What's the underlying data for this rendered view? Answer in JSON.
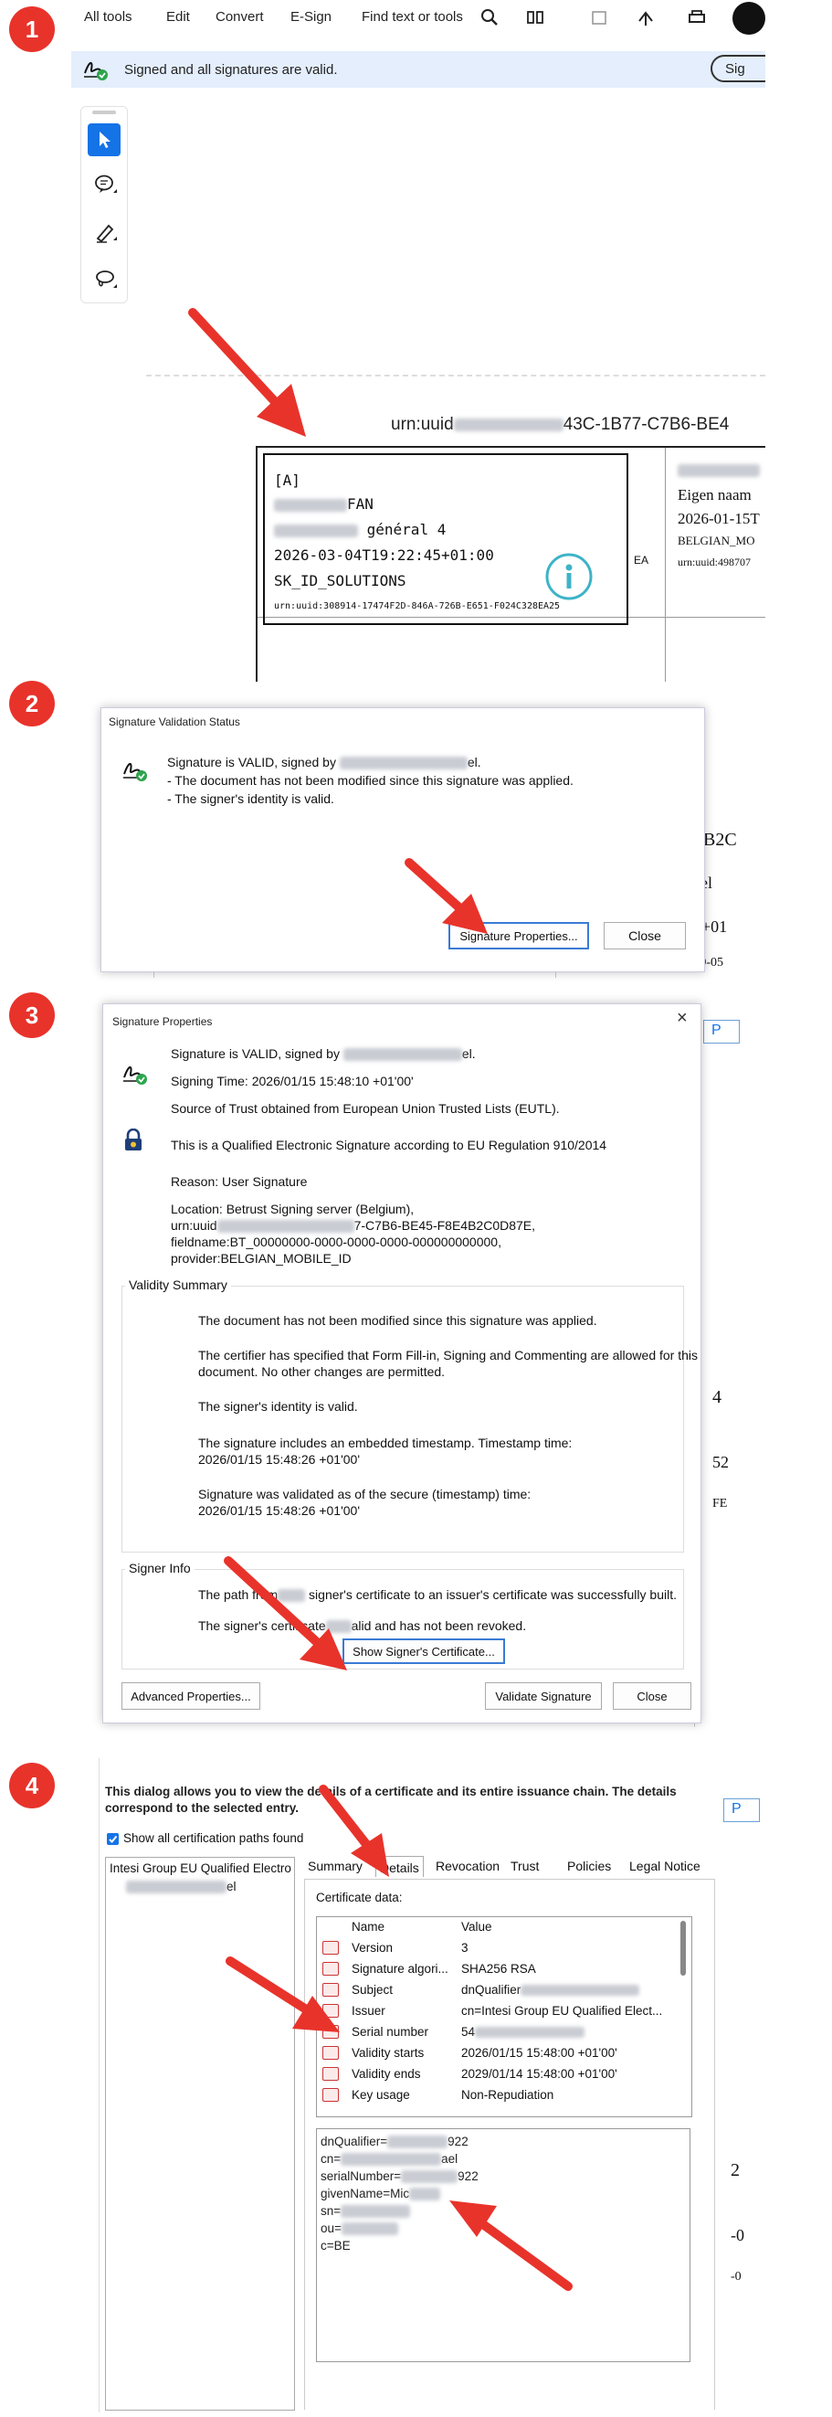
{
  "colors": {
    "accent": "#1473e6",
    "arrow": "#e8332b",
    "valid_bar": "#e4eefc",
    "valid_check": "#2da44e"
  },
  "steps": [
    "1",
    "2",
    "3",
    "4"
  ],
  "toolbar": {
    "menu": [
      "All tools",
      "Edit",
      "Convert",
      "E-Sign"
    ],
    "find": "Find text or tools",
    "sign_btn": "Sig"
  },
  "banner": {
    "text": "Signed and all signatures are valid."
  },
  "tools": [
    "select-icon",
    "comment-icon",
    "draw-icon",
    "lasso-icon"
  ],
  "doc": {
    "urn_prefix": "urn:uuid",
    "urn_suffix": "43C-1B77-C7B6-BE4",
    "sig": {
      "line1": "[A]",
      "name_suffix": "FAN",
      "line3_suffix": "général 4",
      "datetime": "2026-03-04T19:22:45+01:00",
      "org": "SK_ID_SOLUTIONS",
      "uuid": "urn:uuid:308914-17474F2D-846A-726B-E651-F024C328EA25",
      "ea": "EA"
    },
    "right": {
      "eigen": "Eigen naam",
      "date": "2026-01-15T",
      "mobile": "BELGIAN_MO",
      "urn": "urn:uuid:498707"
    }
  },
  "validation": {
    "title": "Signature Validation Status",
    "valid_prefix": "Signature is VALID, signed by",
    "valid_suffix": "el.",
    "line2": "- The document has not been modified since this signature was applied.",
    "line3": "- The signer's identity is valid.",
    "props_btn": "Signature Properties...",
    "close_btn": "Close",
    "bg": {
      "a": "24B2C",
      "b": "nael",
      "c": "52+01",
      "d": "FE9-05"
    }
  },
  "properties": {
    "title": "Signature Properties",
    "close_x": "×",
    "valid_prefix": "Signature is VALID, signed by",
    "valid_suffix": "el.",
    "signing_time": "Signing Time:  2026/01/15 15:48:10 +01'00'",
    "source": "Source of Trust obtained from European Union Trusted Lists (EUTL).",
    "qualified": "This is a Qualified Electronic Signature according to EU Regulation 910/2014",
    "reason": "Reason:  User Signature",
    "location": "Location:  Betrust Signing server (Belgium),",
    "loc_urn_prefix": "urn:uuid",
    "loc_urn_suffix": "7-C7B6-BE45-F8E4B2C0D87E,",
    "fieldname": "fieldname:BT_00000000-0000-0000-0000-000000000000,",
    "provider": "provider:BELGIAN_MOBILE_ID",
    "validity_title": "Validity Summary",
    "v1": "The document has not been modified since this signature was applied.",
    "v2a": "The certifier has specified that Form Fill-in, Signing and Commenting are allowed for this",
    "v2b": "document. No other changes are permitted.",
    "v3": "The signer's identity is valid.",
    "v4a": "The signature includes an embedded timestamp. Timestamp time:",
    "v4b": "2026/01/15 15:48:26 +01'00'",
    "v5a": "Signature was validated as of the secure (timestamp) time:",
    "v5b": "2026/01/15 15:48:26 +01'00'",
    "signer_title": "Signer Info",
    "s1_prefix": "The path from",
    "s1_suffix": "signer's certificate to an issuer's certificate was successfully built.",
    "s2_prefix": "The signer's certificate",
    "s2_suffix": "alid and has not been revoked.",
    "show_cert_btn": "Show Signer's Certificate...",
    "advanced_btn": "Advanced Properties...",
    "validate_btn": "Validate Signature",
    "close_btn": "Close",
    "bg": {
      "a": "P",
      "b": "4",
      "c": "52",
      "d": "FE"
    }
  },
  "certificate": {
    "intro": "This dialog allows you to view the details of a certificate and its entire issuance chain. The details correspond to the selected entry.",
    "show_all": "Show all certification paths found",
    "tree_root": "Intesi Group EU Qualified Electro",
    "tree_child_suffix": "el",
    "tabs": [
      "Summary",
      "Details",
      "Revocation",
      "Trust",
      "Policies",
      "Legal Notice"
    ],
    "data_label": "Certificate data:",
    "col_name": "Name",
    "col_value": "Value",
    "rows": [
      {
        "name": "Version",
        "value": "3"
      },
      {
        "name": "Signature algori...",
        "value": "SHA256 RSA"
      },
      {
        "name": "Subject",
        "value": "dnQualifier"
      },
      {
        "name": "Issuer",
        "value": "cn=Intesi Group EU Qualified Elect..."
      },
      {
        "name": "Serial number",
        "value": "54"
      },
      {
        "name": "Validity starts",
        "value": "2026/01/15 15:48:00 +01'00'"
      },
      {
        "name": "Validity ends",
        "value": "2029/01/14 15:48:00 +01'00'"
      },
      {
        "name": "Key usage",
        "value": "Non-Repudiation"
      }
    ],
    "detail": {
      "dnq": "dnQualifier=",
      "dnq_end": "922",
      "cn": "cn=",
      "cn_end": "ael",
      "serial": "serialNumber=",
      "serial_end": "922",
      "given": "givenName=Mic",
      "sn": "sn=",
      "ou": "ou=",
      "c": "c=BE"
    },
    "bg": {
      "a": "P",
      "b": "2",
      "c": "-0",
      "d": "-0"
    }
  }
}
